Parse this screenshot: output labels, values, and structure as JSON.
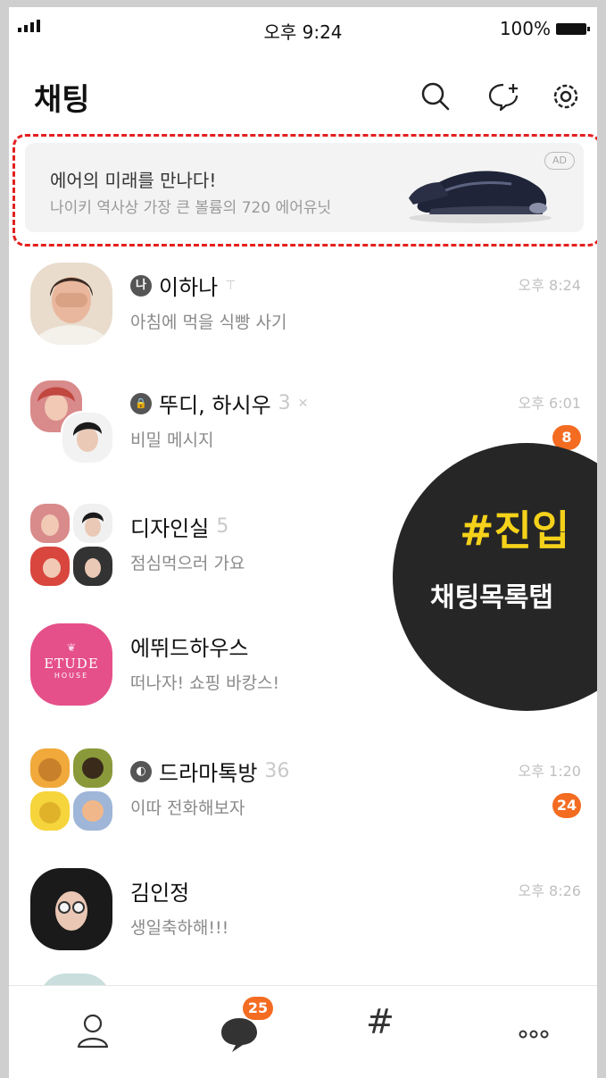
{
  "status_bar": {
    "time": "오후 9:24",
    "battery": "100%"
  },
  "header": {
    "title": "채팅",
    "icons": [
      "search-icon",
      "new-chat-icon",
      "settings-icon"
    ]
  },
  "ad": {
    "title": "에어의 미래를 만나다!",
    "subtitle": "나이키 역사상 가장 큰 볼륨의 720 에어유닛",
    "badge": "AD"
  },
  "chats": [
    {
      "name": "이하나",
      "type_icon": "나",
      "pin": "⊤",
      "count": "",
      "preview": "아침에 먹을 식빵 사기",
      "time": "오후 8:24",
      "unread": ""
    },
    {
      "name": "뚜디, 하시우",
      "type_icon": "🔒",
      "count": "3",
      "preview": "비밀 메시지",
      "time": "오후 6:01",
      "unread": "8"
    },
    {
      "name": "디자인실",
      "count": "5",
      "preview": "점심먹으러 가요",
      "time": "",
      "unread": ""
    },
    {
      "name": "에뛰드하우스",
      "count": "",
      "preview": "떠나자! 쇼핑 바캉스!",
      "time": "",
      "unread": "",
      "logo": {
        "text": "ETUDE",
        "sub": "HOUSE"
      }
    },
    {
      "name": "드라마톡방",
      "type_icon": "◐",
      "count": "36",
      "preview": "이따 전화해보자",
      "time": "오후 1:20",
      "unread": "24"
    },
    {
      "name": "김인정",
      "count": "",
      "preview": "생일축하해!!!",
      "time": "오후 8:26",
      "unread": ""
    }
  ],
  "overlay": {
    "tag": "#진입",
    "label": "채팅목록탭"
  },
  "tabbar": {
    "chat_badge": "25",
    "tabs": [
      "friends-icon",
      "chat-icon",
      "hashtag-icon",
      "more-icon"
    ]
  },
  "colors": {
    "accent": "#f36c21",
    "overlay_bg": "#262626",
    "overlay_tag": "#f5d21a",
    "ad_border": "#e32020"
  }
}
